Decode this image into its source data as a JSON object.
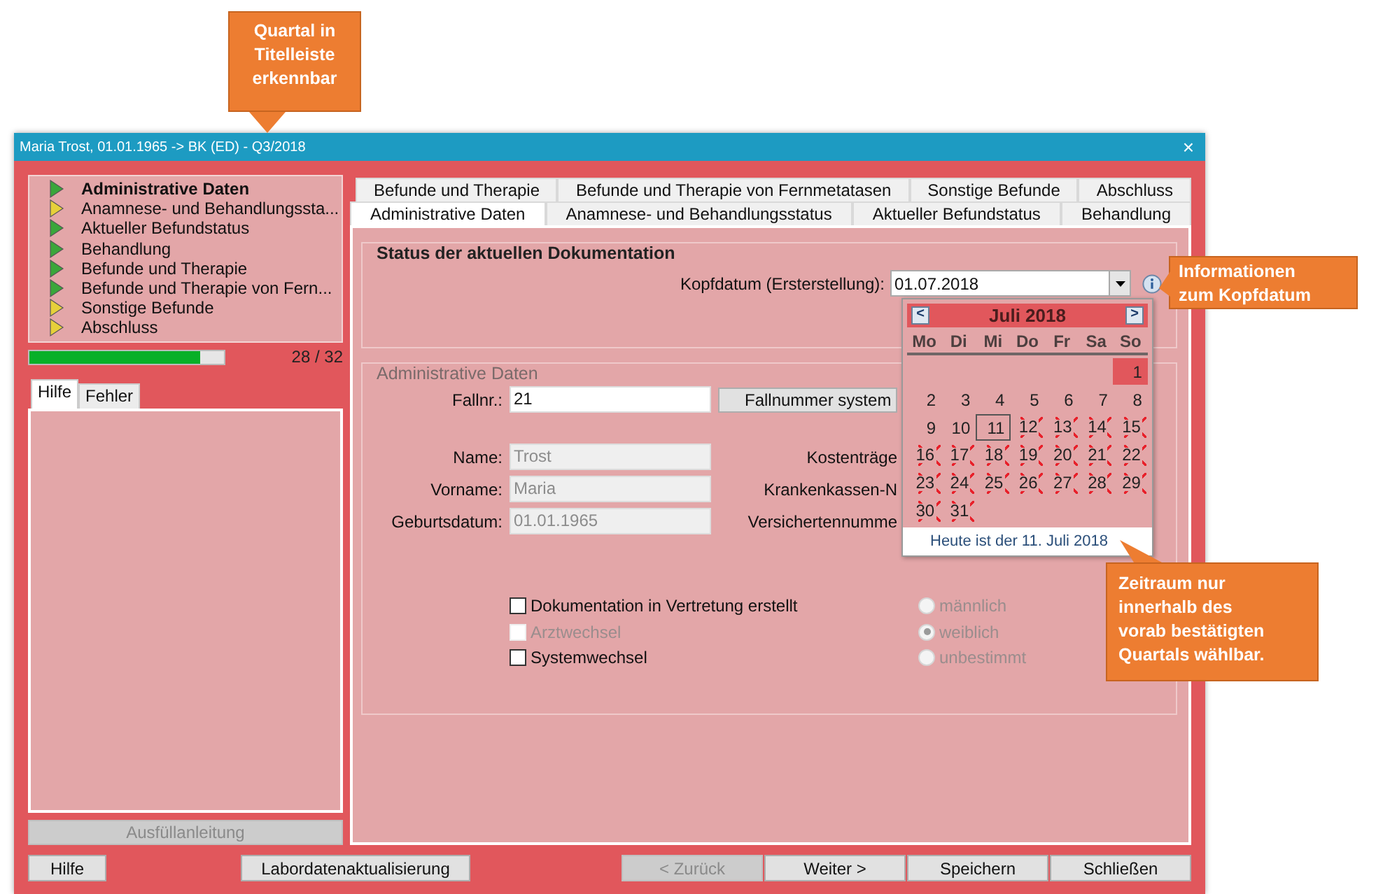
{
  "window": {
    "title": "Maria Trost, 01.01.1965 -> BK (ED) - Q3/2018",
    "close": "×"
  },
  "nav": {
    "items": [
      {
        "label": "Administrative Daten",
        "color": "#3aa63a",
        "selected": true
      },
      {
        "label": "Anamnese- und Behandlungssta...",
        "color": "#e6d03a",
        "selected": false
      },
      {
        "label": "Aktueller Befundstatus",
        "color": "#3aa63a",
        "selected": false
      },
      {
        "label": "Behandlung",
        "color": "#3aa63a",
        "selected": false
      },
      {
        "label": "Befunde und Therapie",
        "color": "#3aa63a",
        "selected": false
      },
      {
        "label": "Befunde und Therapie von Fern...",
        "color": "#3aa63a",
        "selected": false
      },
      {
        "label": "Sonstige Befunde",
        "color": "#e6d03a",
        "selected": false
      },
      {
        "label": "Abschluss",
        "color": "#e6d03a",
        "selected": false
      }
    ],
    "progress": {
      "level": 0.875,
      "text": "28 / 32"
    }
  },
  "help_tabs": [
    {
      "label": "Hilfe",
      "selected": true
    },
    {
      "label": "Fehler",
      "selected": false
    }
  ],
  "help_button": {
    "label": "Ausfüllanleitung",
    "disabled": true
  },
  "tabs": {
    "rows": [
      [
        {
          "label": "Befunde und Therapie",
          "selected": false
        },
        {
          "label": "Befunde und Therapie von Fernmetatasen",
          "selected": false
        },
        {
          "label": "Sonstige Befunde",
          "selected": false
        },
        {
          "label": "Abschluss",
          "selected": false
        }
      ],
      [
        {
          "label": "Administrative Daten",
          "selected": true
        },
        {
          "label": "Anamnese- und Behandlungsstatus",
          "selected": false
        },
        {
          "label": "Aktueller Befundstatus",
          "selected": false
        },
        {
          "label": "Behandlung",
          "selected": false
        }
      ]
    ]
  },
  "status_section": {
    "title": "Status der aktuellen Dokumentation",
    "kopfdatum": {
      "label": "Kopfdatum (Ersterstellung):",
      "value": "01.07.2018"
    }
  },
  "admin_section": {
    "title": "Administrative Daten",
    "fallnr": {
      "label": "Fallnr.:",
      "value": "21"
    },
    "fallnr_button": "Fallnummer system",
    "fields": [
      {
        "label": "Name:",
        "value": "Trost",
        "disabled": true
      },
      {
        "label": "Vorname:",
        "value": "Maria",
        "disabled": true
      },
      {
        "label": "Geburtsdatum:",
        "value": "01.01.1965",
        "disabled": true
      }
    ],
    "right_labels": [
      "Kostenträge",
      "Krankenkassen-N",
      "Versichertennumme"
    ],
    "checkboxes": [
      {
        "label": "Dokumentation in Vertretung erstellt",
        "checked": false,
        "disabled": false
      },
      {
        "label": "Arztwechsel",
        "checked": false,
        "disabled": true
      },
      {
        "label": "Systemwechsel",
        "checked": false,
        "disabled": false
      }
    ],
    "radios": [
      {
        "label": "männlich",
        "selected": false,
        "disabled": true
      },
      {
        "label": "weiblich",
        "selected": true,
        "disabled": true
      },
      {
        "label": "unbestimmt",
        "selected": false,
        "disabled": true
      }
    ]
  },
  "calendar": {
    "month": "Juli 2018",
    "prev": "<",
    "next": ">",
    "weekdays": [
      "Mo",
      "Di",
      "Mi",
      "Do",
      "Fr",
      "Sa",
      "So"
    ],
    "weeks": [
      [
        {
          "label": "1",
          "selected": true,
          "crossed": false,
          "today": false
        }
      ],
      [
        {
          "label": "2",
          "selected": false,
          "crossed": false,
          "today": false
        },
        {
          "label": "3",
          "selected": false,
          "crossed": false,
          "today": false
        },
        {
          "label": "4",
          "selected": false,
          "crossed": false,
          "today": false
        },
        {
          "label": "5",
          "selected": false,
          "crossed": false,
          "today": false
        },
        {
          "label": "6",
          "selected": false,
          "crossed": false,
          "today": false
        },
        {
          "label": "7",
          "selected": false,
          "crossed": false,
          "today": false
        },
        {
          "label": "8",
          "selected": false,
          "crossed": false,
          "today": false
        }
      ],
      [
        {
          "label": "9",
          "selected": false,
          "crossed": false,
          "today": false
        },
        {
          "label": "10",
          "selected": false,
          "crossed": false,
          "today": false
        },
        {
          "label": "11",
          "selected": false,
          "crossed": false,
          "today": true
        },
        {
          "label": "12",
          "selected": false,
          "crossed": true,
          "today": false
        },
        {
          "label": "13",
          "selected": false,
          "crossed": true,
          "today": false
        },
        {
          "label": "14",
          "selected": false,
          "crossed": true,
          "today": false
        },
        {
          "label": "15",
          "selected": false,
          "crossed": true,
          "today": false
        }
      ],
      [
        {
          "label": "16",
          "selected": false,
          "crossed": true,
          "today": false
        },
        {
          "label": "17",
          "selected": false,
          "crossed": true,
          "today": false
        },
        {
          "label": "18",
          "selected": false,
          "crossed": true,
          "today": false
        },
        {
          "label": "19",
          "selected": false,
          "crossed": true,
          "today": false
        },
        {
          "label": "20",
          "selected": false,
          "crossed": true,
          "today": false
        },
        {
          "label": "21",
          "selected": false,
          "crossed": true,
          "today": false
        },
        {
          "label": "22",
          "selected": false,
          "crossed": true,
          "today": false
        }
      ],
      [
        {
          "label": "23",
          "selected": false,
          "crossed": true,
          "today": false
        },
        {
          "label": "24",
          "selected": false,
          "crossed": true,
          "today": false
        },
        {
          "label": "25",
          "selected": false,
          "crossed": true,
          "today": false
        },
        {
          "label": "26",
          "selected": false,
          "crossed": true,
          "today": false
        },
        {
          "label": "27",
          "selected": false,
          "crossed": true,
          "today": false
        },
        {
          "label": "28",
          "selected": false,
          "crossed": true,
          "today": false
        },
        {
          "label": "29",
          "selected": false,
          "crossed": true,
          "today": false
        }
      ],
      [
        {
          "label": "30",
          "selected": false,
          "crossed": true,
          "today": false
        },
        {
          "label": "31",
          "selected": false,
          "crossed": true,
          "today": false
        }
      ]
    ],
    "footer": "Heute ist der 11. Juli 2018"
  },
  "buttons_left": [
    {
      "label": "Hilfe",
      "disabled": false
    },
    {
      "label": "Labordatenaktualisierung",
      "disabled": false
    }
  ],
  "buttons_right": [
    {
      "label": "< Zurück",
      "disabled": true
    },
    {
      "label": "Weiter >",
      "disabled": false
    },
    {
      "label": "Speichern",
      "disabled": false
    },
    {
      "label": "Schließen",
      "disabled": false
    }
  ],
  "callouts": [
    {
      "kind": "title",
      "text": "Quartal in Titelleiste erkennbar"
    },
    {
      "kind": "info",
      "text": "Informationen zum Kopfdatum"
    },
    {
      "kind": "calendar",
      "text": "Zeitraum nur innerhalb des vorab bestätigten Quartals wählbar."
    }
  ]
}
